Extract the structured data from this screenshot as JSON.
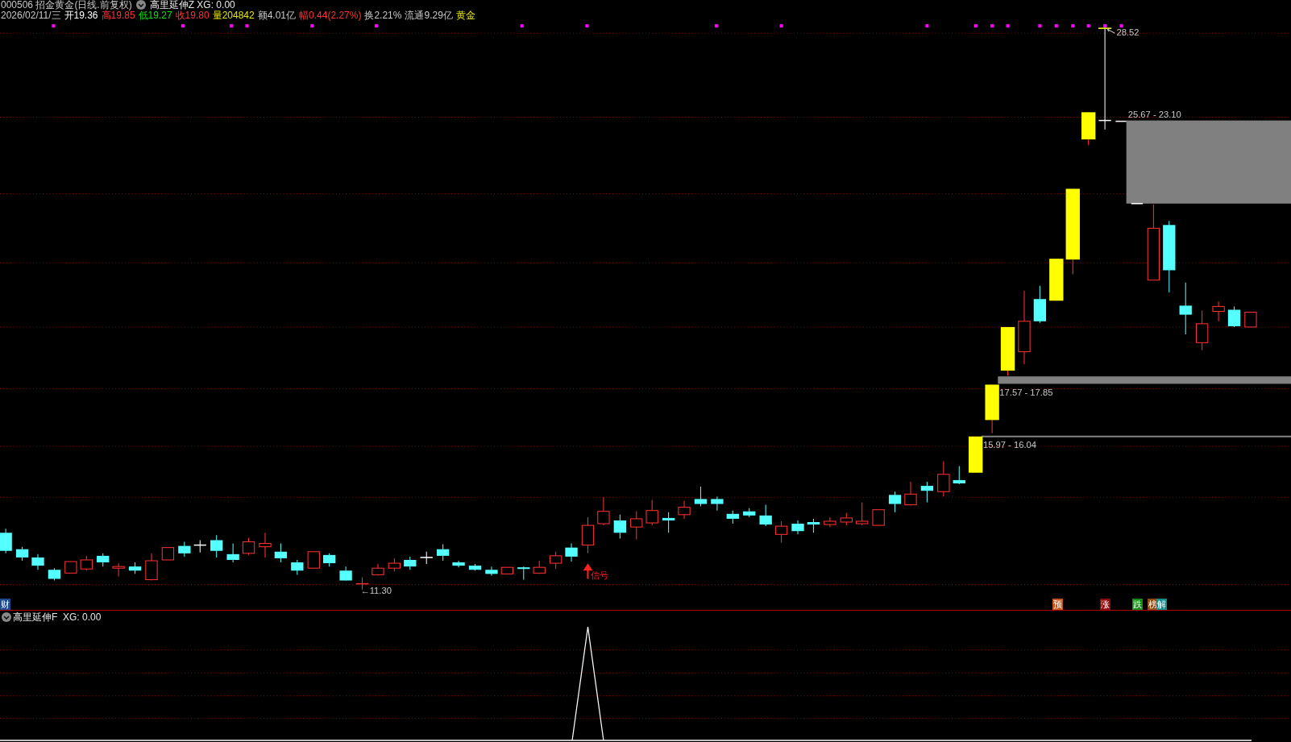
{
  "header": {
    "code_name": "000506 招金黄金(日线.前复权)",
    "indicator": "高里延伸Z XG: 0.00"
  },
  "quote": [
    {
      "text": "2026/02/11/三",
      "color": "#c8c8c8"
    },
    {
      "text": "开19.36",
      "color": "#ffffff"
    },
    {
      "text": "高19.85",
      "color": "#ff3232"
    },
    {
      "text": "低19.27",
      "color": "#00e600"
    },
    {
      "text": "收19.80",
      "color": "#ff3232"
    },
    {
      "text": "量204842",
      "color": "#e6e600"
    },
    {
      "text": "额4.01亿",
      "color": "#c8c8c8"
    },
    {
      "text": "幅0.44(2.27%)",
      "color": "#ff3232"
    },
    {
      "text": "换2.21%",
      "color": "#c8c8c8"
    },
    {
      "text": "流通9.29亿",
      "color": "#c8c8c8"
    },
    {
      "text": "黄金",
      "color": "#e6e600"
    }
  ],
  "main_chart": {
    "high_label": "28.52",
    "low_label": "←11.30",
    "zones": [
      {
        "range": "25.67 - 23.10"
      },
      {
        "range": "17.57 - 17.85"
      },
      {
        "range": "15.97 - 16.04"
      }
    ],
    "signal": "信号",
    "tags": [
      {
        "text": "财",
        "color": "#1c4a8c"
      },
      {
        "text": "预",
        "color": "#c4561c"
      },
      {
        "text": "涨",
        "color": "#8c0a0a"
      },
      {
        "text": "跌",
        "color": "#148c14"
      },
      {
        "text": "榜",
        "color": "#8c4a14"
      },
      {
        "text": "解",
        "color": "#148c8c"
      }
    ]
  },
  "sub_panel": {
    "indicator": "高里延伸F  XG: 0.00"
  }
}
